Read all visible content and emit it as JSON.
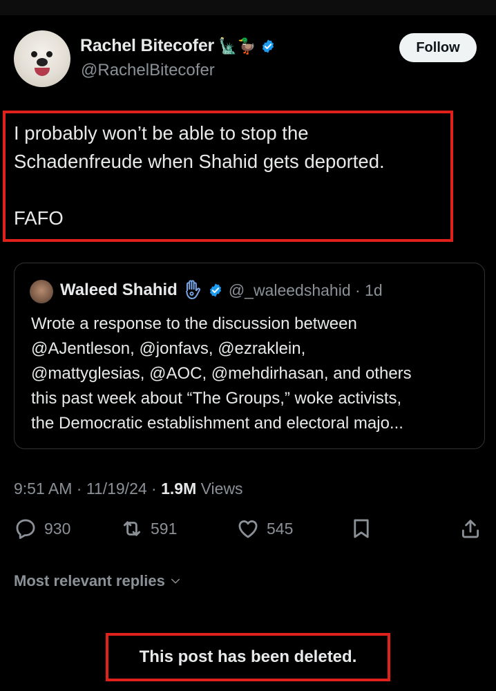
{
  "author": {
    "display_name": "Rachel Bitecofer",
    "name_emojis": "🗽🦆",
    "handle": "@RachelBitecofer",
    "follow_label": "Follow"
  },
  "post": {
    "line1": "I probably won’t be able to stop the",
    "line2": "Schadenfreude when Shahid gets deported.",
    "line3": "FAFO"
  },
  "quote": {
    "display_name": "Waleed Shahid",
    "handle_time": "@_waleedshahid · 1d",
    "line1": "Wrote a response to the discussion between",
    "line2": "@AJentleson, @jonfavs, @ezraklein,",
    "line3": "@mattyglesias, @AOC, @mehdirhasan, and others",
    "line4": "this past week about “The Groups,” woke activists,",
    "line5": "the Democratic establishment and electoral majo..."
  },
  "meta": {
    "time_date": "9:51 AM · 11/19/24 · ",
    "views_count": "1.9M",
    "views_label": " Views"
  },
  "actions": {
    "replies": "930",
    "reposts": "591",
    "likes": "545"
  },
  "icons": {
    "reply": "reply-icon",
    "repost": "repost-icon",
    "like": "heart-icon",
    "bookmark": "bookmark-icon",
    "share": "share-icon",
    "verified": "verified-badge-icon",
    "hamsa": "hamsa-icon"
  },
  "replies_filter": "Most relevant replies",
  "deleted_notice": "This post has been deleted.",
  "colors": {
    "background": "#000000",
    "text": "#e7e9ea",
    "muted": "#8b9197",
    "verified": "#1d9bf0",
    "highlight_box": "#e0201b"
  }
}
